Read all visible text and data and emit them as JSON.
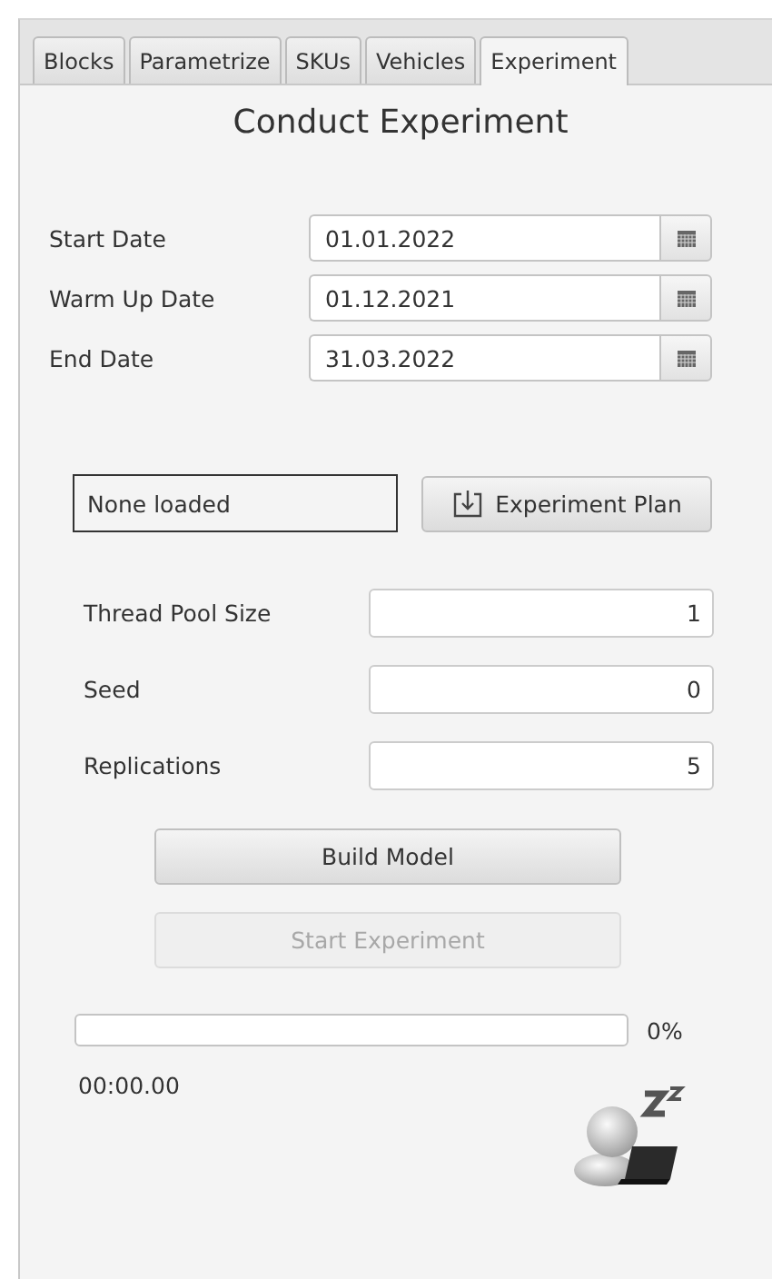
{
  "tabs": [
    {
      "label": "Blocks",
      "selected": false
    },
    {
      "label": "Parametrize",
      "selected": false
    },
    {
      "label": "SKUs",
      "selected": false
    },
    {
      "label": "Vehicles",
      "selected": false
    },
    {
      "label": "Experiment",
      "selected": true
    }
  ],
  "title": "Conduct Experiment",
  "dates": [
    {
      "label": "Start Date",
      "value": "01.01.2022"
    },
    {
      "label": "Warm Up Date",
      "value": "01.12.2021"
    },
    {
      "label": "End Date",
      "value": "31.03.2022"
    }
  ],
  "plan": {
    "status": "None loaded",
    "button": "Experiment Plan"
  },
  "numbers": [
    {
      "label": "Thread Pool Size",
      "value": "1"
    },
    {
      "label": "Seed",
      "value": "0"
    },
    {
      "label": "Replications",
      "value": "5"
    }
  ],
  "buttons": [
    {
      "label": "Build Model",
      "disabled": false
    },
    {
      "label": "Start Experiment",
      "disabled": true
    }
  ],
  "progress": {
    "level": 0,
    "reading": "0%"
  },
  "elapsed": "00:00.00"
}
